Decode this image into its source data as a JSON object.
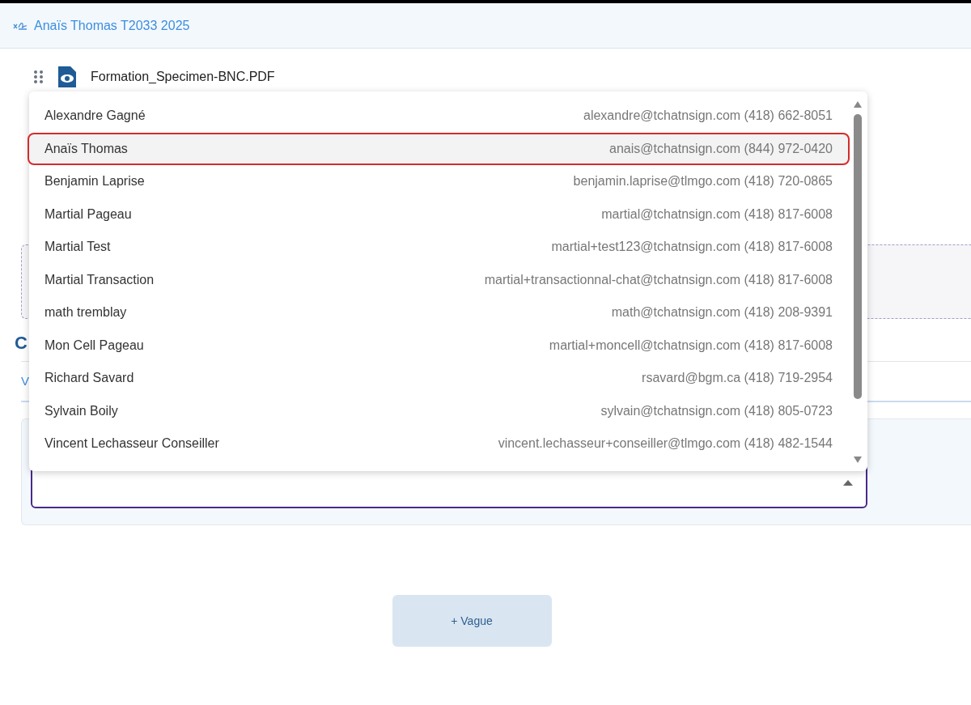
{
  "header": {
    "title": "Anaïs Thomas T2033 2025"
  },
  "document": {
    "filename": "Formation_Specimen-BNC.PDF"
  },
  "section_heading": "C",
  "tab": {
    "label": "V"
  },
  "select_field": {
    "expanded": true
  },
  "dropdown": {
    "options": [
      {
        "name": "Alexandre Gagné",
        "detail": "alexandre@tchatnsign.com (418) 662-8051",
        "selected": false
      },
      {
        "name": "Anaïs Thomas",
        "detail": "anais@tchatnsign.com (844) 972-0420",
        "selected": true
      },
      {
        "name": "Benjamin Laprise",
        "detail": "benjamin.laprise@tlmgo.com (418) 720-0865",
        "selected": false
      },
      {
        "name": "Martial Pageau",
        "detail": "martial@tchatnsign.com (418) 817-6008",
        "selected": false
      },
      {
        "name": "Martial Test",
        "detail": "martial+test123@tchatnsign.com (418) 817-6008",
        "selected": false
      },
      {
        "name": "Martial Transaction",
        "detail": "martial+transactionnal-chat@tchatnsign.com (418) 817-6008",
        "selected": false
      },
      {
        "name": "math tremblay",
        "detail": "math@tchatnsign.com (418) 208-9391",
        "selected": false
      },
      {
        "name": "Mon Cell Pageau",
        "detail": "martial+moncell@tchatnsign.com (418) 817-6008",
        "selected": false
      },
      {
        "name": "Richard Savard",
        "detail": "rsavard@bgm.ca (418) 719-2954",
        "selected": false
      },
      {
        "name": "Sylvain Boily",
        "detail": "sylvain@tchatnsign.com (418) 805-0723",
        "selected": false
      },
      {
        "name": "Vincent Lechasseur Conseiller",
        "detail": "vincent.lechasseur+conseiller@tlmgo.com (418) 482-1544",
        "selected": false
      }
    ]
  },
  "add_button": {
    "label": "+ Vague"
  }
}
